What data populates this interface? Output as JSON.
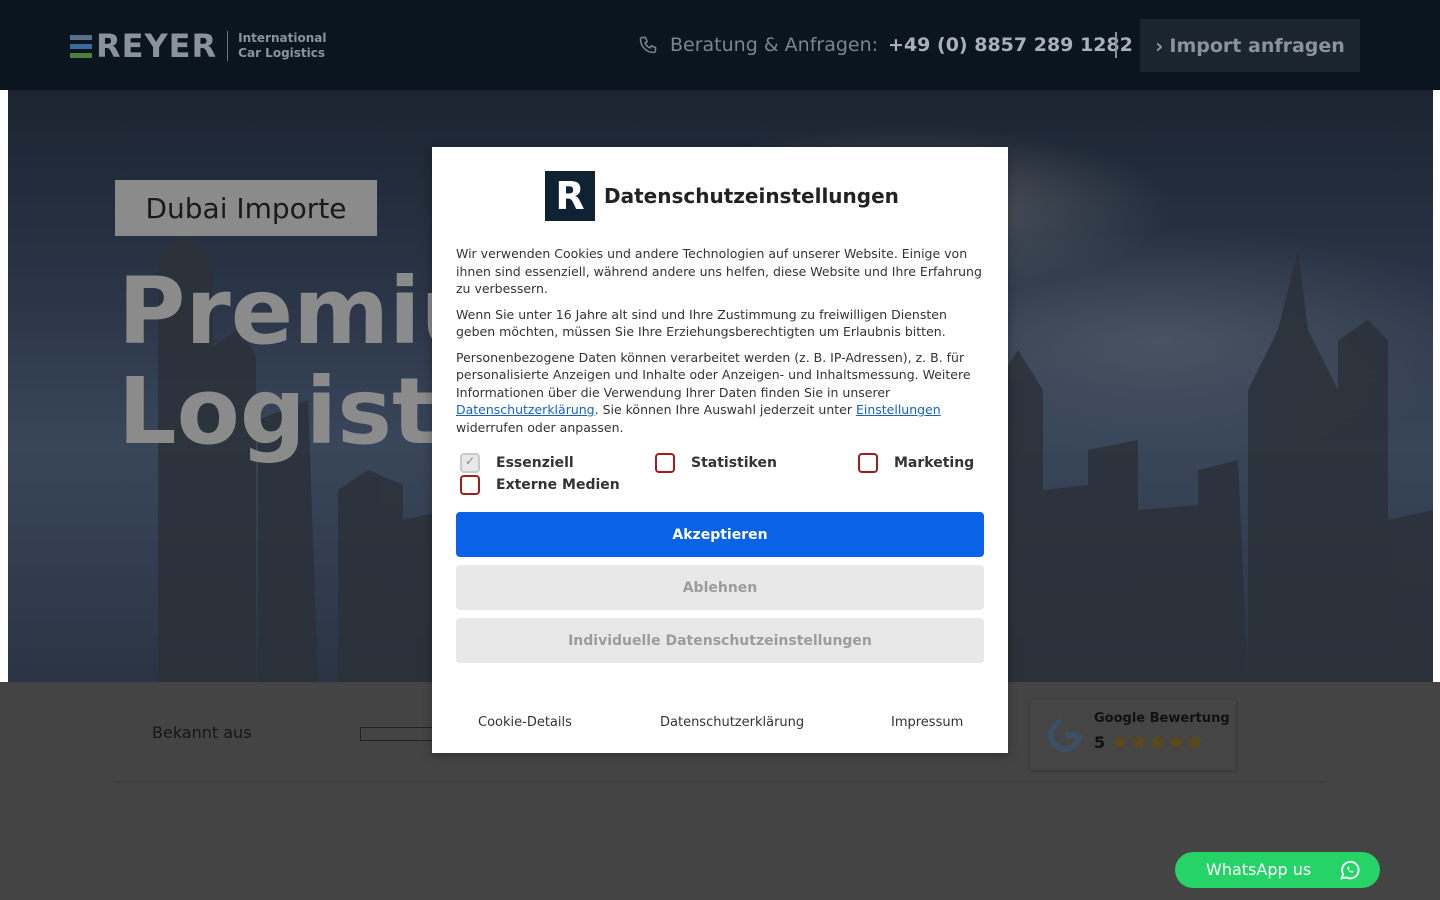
{
  "header": {
    "logo_word": "REYER",
    "logo_tagline_1": "International",
    "logo_tagline_2": "Car Logistics",
    "contact_label": "Beratung & Anfragen:",
    "contact_number": "+49 (0) 8857 289 1282",
    "cta_label": "Import anfragen",
    "colors": {
      "logo_bar_1": "#5a6f8a",
      "logo_bar_2": "#3d6a9e",
      "logo_bar_3": "#4e7f3a"
    }
  },
  "hero": {
    "badge": "Dubai Importe",
    "headline": "Premiu\nLogisti"
  },
  "press": {
    "label": "Bekannt aus"
  },
  "google_rating": {
    "title": "Google Bewertung",
    "score": "5",
    "stars": "★★★★★"
  },
  "consent": {
    "title": "Datenschutzeinstellungen",
    "logo_letter": "R",
    "paragraph_1": "Wir verwenden Cookies und andere Technologien auf unserer Website. Einige von ihnen sind essenziell, während andere uns helfen, diese Website und Ihre Erfahrung zu verbessern.",
    "paragraph_2": "Wenn Sie unter 16 Jahre alt sind und Ihre Zustimmung zu freiwilligen Diensten geben möchten, müssen Sie Ihre Erziehungsberechtigten um Erlaubnis bitten.",
    "paragraph_3_a": "Personenbezogene Daten können verarbeitet werden (z. B. IP-Adressen), z. B. für personalisierte Anzeigen und Inhalte oder Anzeigen- und Inhaltsmessung. Weitere Informationen über die Verwendung Ihrer Daten finden Sie in unserer ",
    "paragraph_3_link_1": "Datenschutzerklärung",
    "paragraph_3_b": ". Sie können Ihre Auswahl jederzeit unter ",
    "paragraph_3_link_2": "Einstellungen",
    "paragraph_3_c": " widerrufen oder anpassen.",
    "checkboxes": [
      {
        "label": "Essenziell",
        "checked": true,
        "disabled": true
      },
      {
        "label": "Statistiken",
        "checked": false
      },
      {
        "label": "Marketing",
        "checked": false
      },
      {
        "label": "Externe Medien",
        "checked": false
      }
    ],
    "accept_label": "Akzeptieren",
    "reject_label": "Ablehnen",
    "individual_label": "Individuelle Datenschutzeinstellungen",
    "footer_links": [
      "Cookie-Details",
      "Datenschutzerklärung",
      "Impressum"
    ]
  },
  "whatsapp": {
    "label": "WhatsApp us"
  }
}
